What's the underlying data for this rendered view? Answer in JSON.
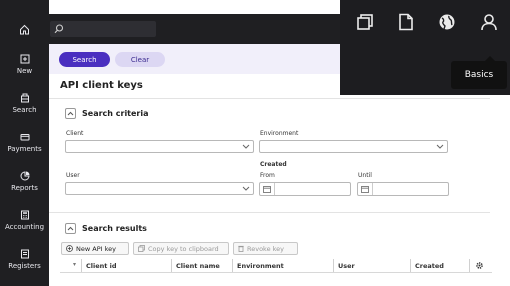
{
  "nav": {
    "items": [
      {
        "label": "New",
        "icon": "new-icon"
      },
      {
        "label": "Search",
        "icon": "search-icon"
      },
      {
        "label": "Payments",
        "icon": "payments-icon"
      },
      {
        "label": "Reports",
        "icon": "reports-icon"
      },
      {
        "label": "Accounting",
        "icon": "accounting-icon"
      },
      {
        "label": "Registers",
        "icon": "registers-icon"
      }
    ]
  },
  "top_panel": {
    "icons": [
      "windows-icon",
      "document-icon",
      "globe-icon",
      "user-icon"
    ],
    "tooltip": "Basics"
  },
  "actions": {
    "search_label": "Search",
    "clear_label": "Clear"
  },
  "page": {
    "title": "API client keys"
  },
  "criteria": {
    "title": "Search criteria",
    "client_label": "Client",
    "environment_label": "Environment",
    "user_label": "User",
    "created_label": "Created",
    "from_label": "From",
    "until_label": "Until"
  },
  "results": {
    "title": "Search results",
    "buttons": {
      "new": "New API key",
      "copy": "Copy key to clipboard",
      "revoke": "Revoke key"
    },
    "columns": [
      "Client id",
      "Client name",
      "Environment",
      "User",
      "Created"
    ]
  },
  "colors": {
    "accent": "#4a2fc0",
    "nav_bg": "#1f1f22",
    "action_bg": "#f1effa"
  }
}
